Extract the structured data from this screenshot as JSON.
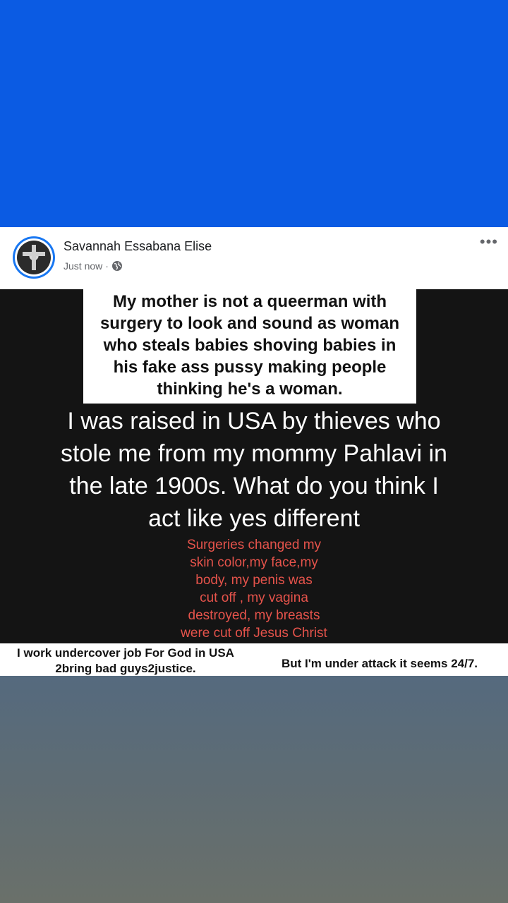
{
  "post": {
    "author": "Savannah Essabana Elise",
    "timestamp": "Just now",
    "separator": "·",
    "privacy_icon": "globe-icon",
    "more_label": "•••"
  },
  "image_text": {
    "white_box_lines": [
      "My mother is not a queerman with",
      "surgery to look and sound as woman",
      "who steals babies shoving babies in",
      "his fake ass pussy making people",
      "thinking he's a woman."
    ],
    "big_lines": [
      "I was raised in USA by thieves who",
      "stole me from my mommy Pahlavi in",
      "the late 1900s. What do you think I",
      "act like yes different"
    ],
    "red_lines": [
      "Surgeries changed my",
      "skin color,my face,my",
      "body, my penis was",
      "cut off , my vagina",
      "destroyed, my breasts",
      "were cut off Jesus Christ"
    ],
    "bottom_left_lines": [
      "I work undercover job For God in USA",
      "2bring bad guys2justice."
    ],
    "bottom_right": "But I'm under attack it seems 24/7."
  },
  "colors": {
    "top_background": "#0b5be3",
    "photo_background": "#141414",
    "red_text": "#e5534b",
    "avatar_ring": "#1877f2"
  }
}
